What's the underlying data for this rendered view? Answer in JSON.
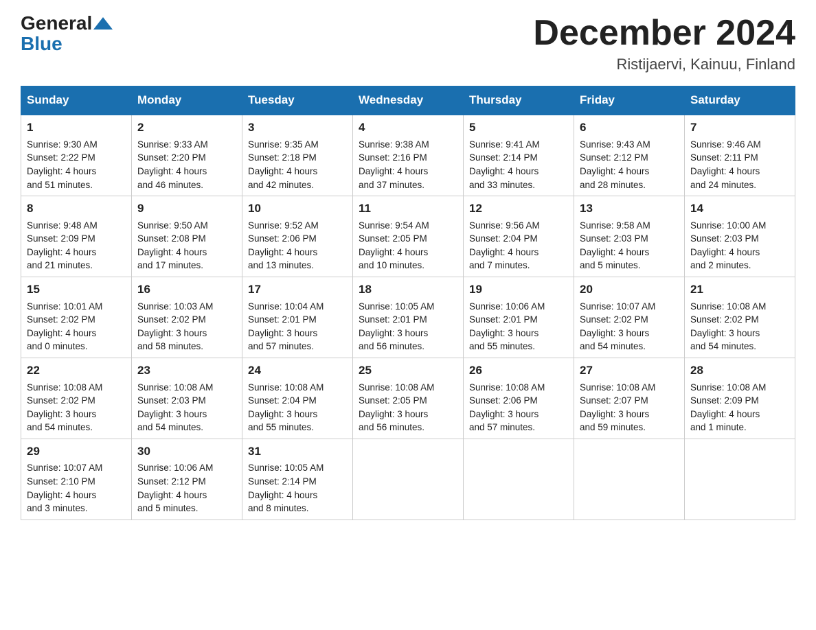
{
  "header": {
    "logo_general": "General",
    "logo_blue": "Blue",
    "month_title": "December 2024",
    "location": "Ristijaervi, Kainuu, Finland"
  },
  "days_of_week": [
    "Sunday",
    "Monday",
    "Tuesday",
    "Wednesday",
    "Thursday",
    "Friday",
    "Saturday"
  ],
  "weeks": [
    [
      {
        "day": 1,
        "lines": [
          "Sunrise: 9:30 AM",
          "Sunset: 2:22 PM",
          "Daylight: 4 hours",
          "and 51 minutes."
        ]
      },
      {
        "day": 2,
        "lines": [
          "Sunrise: 9:33 AM",
          "Sunset: 2:20 PM",
          "Daylight: 4 hours",
          "and 46 minutes."
        ]
      },
      {
        "day": 3,
        "lines": [
          "Sunrise: 9:35 AM",
          "Sunset: 2:18 PM",
          "Daylight: 4 hours",
          "and 42 minutes."
        ]
      },
      {
        "day": 4,
        "lines": [
          "Sunrise: 9:38 AM",
          "Sunset: 2:16 PM",
          "Daylight: 4 hours",
          "and 37 minutes."
        ]
      },
      {
        "day": 5,
        "lines": [
          "Sunrise: 9:41 AM",
          "Sunset: 2:14 PM",
          "Daylight: 4 hours",
          "and 33 minutes."
        ]
      },
      {
        "day": 6,
        "lines": [
          "Sunrise: 9:43 AM",
          "Sunset: 2:12 PM",
          "Daylight: 4 hours",
          "and 28 minutes."
        ]
      },
      {
        "day": 7,
        "lines": [
          "Sunrise: 9:46 AM",
          "Sunset: 2:11 PM",
          "Daylight: 4 hours",
          "and 24 minutes."
        ]
      }
    ],
    [
      {
        "day": 8,
        "lines": [
          "Sunrise: 9:48 AM",
          "Sunset: 2:09 PM",
          "Daylight: 4 hours",
          "and 21 minutes."
        ]
      },
      {
        "day": 9,
        "lines": [
          "Sunrise: 9:50 AM",
          "Sunset: 2:08 PM",
          "Daylight: 4 hours",
          "and 17 minutes."
        ]
      },
      {
        "day": 10,
        "lines": [
          "Sunrise: 9:52 AM",
          "Sunset: 2:06 PM",
          "Daylight: 4 hours",
          "and 13 minutes."
        ]
      },
      {
        "day": 11,
        "lines": [
          "Sunrise: 9:54 AM",
          "Sunset: 2:05 PM",
          "Daylight: 4 hours",
          "and 10 minutes."
        ]
      },
      {
        "day": 12,
        "lines": [
          "Sunrise: 9:56 AM",
          "Sunset: 2:04 PM",
          "Daylight: 4 hours",
          "and 7 minutes."
        ]
      },
      {
        "day": 13,
        "lines": [
          "Sunrise: 9:58 AM",
          "Sunset: 2:03 PM",
          "Daylight: 4 hours",
          "and 5 minutes."
        ]
      },
      {
        "day": 14,
        "lines": [
          "Sunrise: 10:00 AM",
          "Sunset: 2:03 PM",
          "Daylight: 4 hours",
          "and 2 minutes."
        ]
      }
    ],
    [
      {
        "day": 15,
        "lines": [
          "Sunrise: 10:01 AM",
          "Sunset: 2:02 PM",
          "Daylight: 4 hours",
          "and 0 minutes."
        ]
      },
      {
        "day": 16,
        "lines": [
          "Sunrise: 10:03 AM",
          "Sunset: 2:02 PM",
          "Daylight: 3 hours",
          "and 58 minutes."
        ]
      },
      {
        "day": 17,
        "lines": [
          "Sunrise: 10:04 AM",
          "Sunset: 2:01 PM",
          "Daylight: 3 hours",
          "and 57 minutes."
        ]
      },
      {
        "day": 18,
        "lines": [
          "Sunrise: 10:05 AM",
          "Sunset: 2:01 PM",
          "Daylight: 3 hours",
          "and 56 minutes."
        ]
      },
      {
        "day": 19,
        "lines": [
          "Sunrise: 10:06 AM",
          "Sunset: 2:01 PM",
          "Daylight: 3 hours",
          "and 55 minutes."
        ]
      },
      {
        "day": 20,
        "lines": [
          "Sunrise: 10:07 AM",
          "Sunset: 2:02 PM",
          "Daylight: 3 hours",
          "and 54 minutes."
        ]
      },
      {
        "day": 21,
        "lines": [
          "Sunrise: 10:08 AM",
          "Sunset: 2:02 PM",
          "Daylight: 3 hours",
          "and 54 minutes."
        ]
      }
    ],
    [
      {
        "day": 22,
        "lines": [
          "Sunrise: 10:08 AM",
          "Sunset: 2:02 PM",
          "Daylight: 3 hours",
          "and 54 minutes."
        ]
      },
      {
        "day": 23,
        "lines": [
          "Sunrise: 10:08 AM",
          "Sunset: 2:03 PM",
          "Daylight: 3 hours",
          "and 54 minutes."
        ]
      },
      {
        "day": 24,
        "lines": [
          "Sunrise: 10:08 AM",
          "Sunset: 2:04 PM",
          "Daylight: 3 hours",
          "and 55 minutes."
        ]
      },
      {
        "day": 25,
        "lines": [
          "Sunrise: 10:08 AM",
          "Sunset: 2:05 PM",
          "Daylight: 3 hours",
          "and 56 minutes."
        ]
      },
      {
        "day": 26,
        "lines": [
          "Sunrise: 10:08 AM",
          "Sunset: 2:06 PM",
          "Daylight: 3 hours",
          "and 57 minutes."
        ]
      },
      {
        "day": 27,
        "lines": [
          "Sunrise: 10:08 AM",
          "Sunset: 2:07 PM",
          "Daylight: 3 hours",
          "and 59 minutes."
        ]
      },
      {
        "day": 28,
        "lines": [
          "Sunrise: 10:08 AM",
          "Sunset: 2:09 PM",
          "Daylight: 4 hours",
          "and 1 minute."
        ]
      }
    ],
    [
      {
        "day": 29,
        "lines": [
          "Sunrise: 10:07 AM",
          "Sunset: 2:10 PM",
          "Daylight: 4 hours",
          "and 3 minutes."
        ]
      },
      {
        "day": 30,
        "lines": [
          "Sunrise: 10:06 AM",
          "Sunset: 2:12 PM",
          "Daylight: 4 hours",
          "and 5 minutes."
        ]
      },
      {
        "day": 31,
        "lines": [
          "Sunrise: 10:05 AM",
          "Sunset: 2:14 PM",
          "Daylight: 4 hours",
          "and 8 minutes."
        ]
      },
      null,
      null,
      null,
      null
    ]
  ]
}
